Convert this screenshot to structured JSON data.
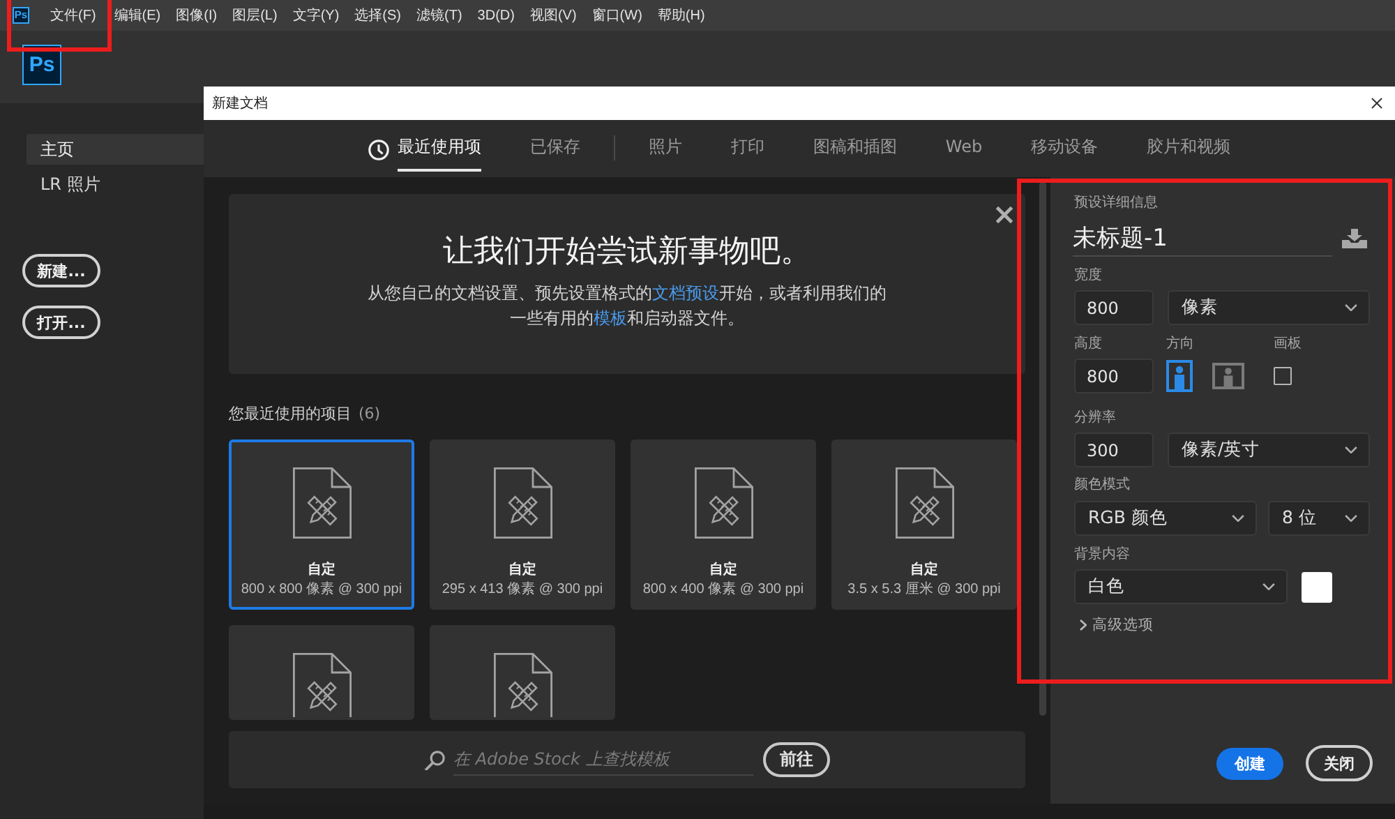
{
  "menubar": {
    "logo": "Ps",
    "items": [
      "文件(F)",
      "编辑(E)",
      "图像(I)",
      "图层(L)",
      "文字(Y)",
      "选择(S)",
      "滤镜(T)",
      "3D(D)",
      "视图(V)",
      "窗口(W)",
      "帮助(H)"
    ],
    "highlighted": true
  },
  "home": {
    "logo": "Ps",
    "nav": [
      {
        "label": "主页",
        "selected": true
      },
      {
        "label": "LR 照片",
        "selected": false
      }
    ],
    "buttons": [
      "新建...",
      "打开..."
    ]
  },
  "dialog": {
    "title": "新建文档",
    "tabs": [
      {
        "label": "最近使用项",
        "kind": "history",
        "selected": true
      },
      {
        "label": "已保存",
        "kind": "saved",
        "selected": false
      },
      {
        "label": "照片",
        "kind": "preset",
        "selected": false
      },
      {
        "label": "打印",
        "kind": "preset",
        "selected": false
      },
      {
        "label": "图稿和插图",
        "kind": "preset",
        "selected": false
      },
      {
        "label": "Web",
        "kind": "preset",
        "selected": false
      },
      {
        "label": "移动设备",
        "kind": "preset",
        "selected": false
      },
      {
        "label": "胶片和视频",
        "kind": "preset",
        "selected": false
      }
    ],
    "banner": {
      "title": "让我们开始尝试新事物吧。",
      "text": [
        {
          "kind": "text",
          "text": "从您自己的文档设置、预先设置格式的"
        },
        {
          "kind": "link",
          "text": "文档预设"
        },
        {
          "kind": "text",
          "text": "开始，或者利用我们的一些有用的"
        },
        {
          "kind": "link",
          "text": "模板"
        },
        {
          "kind": "text",
          "text": "和启动器文件。"
        }
      ]
    },
    "recent": {
      "title": "您最近使用的项目",
      "count": "(6)",
      "items": [
        {
          "name": "自定",
          "size": "800 x 800 像素 @ 300 ppi",
          "selected": true
        },
        {
          "name": "自定",
          "size": "295 x 413 像素 @ 300 ppi",
          "selected": false
        },
        {
          "name": "自定",
          "size": "800 x 400 像素 @ 300 ppi",
          "selected": false
        },
        {
          "name": "自定",
          "size": "3.5 x 5.3 厘米 @ 300 ppi",
          "selected": false
        },
        {
          "selected": false
        },
        {
          "selected": false
        }
      ]
    },
    "search": {
      "placeholder": "在 Adobe Stock 上查找模板",
      "button": "前往"
    },
    "details": {
      "highlighted": true,
      "heading": "预设详细信息",
      "name": "未标题-1",
      "width": {
        "label": "宽度",
        "value": "800",
        "unit": "像素"
      },
      "height": {
        "label": "高度",
        "value": "800"
      },
      "orientation": {
        "label": "方向",
        "options": [
          {
            "kind": "portrait",
            "selected": true
          },
          {
            "kind": "landscape",
            "selected": false
          }
        ]
      },
      "artboard": {
        "label": "画板",
        "checked": false
      },
      "resolution": {
        "label": "分辨率",
        "value": "300",
        "unit": "像素/英寸"
      },
      "color_mode": {
        "label": "颜色模式",
        "mode": "RGB 颜色",
        "depth": "8 位"
      },
      "background": {
        "label": "背景内容",
        "value": "白色",
        "color": "#ffffff"
      },
      "advanced": {
        "label": "高级选项",
        "expanded": false
      }
    },
    "actions": [
      {
        "label": "创建",
        "kind": "primary"
      },
      {
        "label": "关闭",
        "kind": "secondary"
      }
    ]
  }
}
